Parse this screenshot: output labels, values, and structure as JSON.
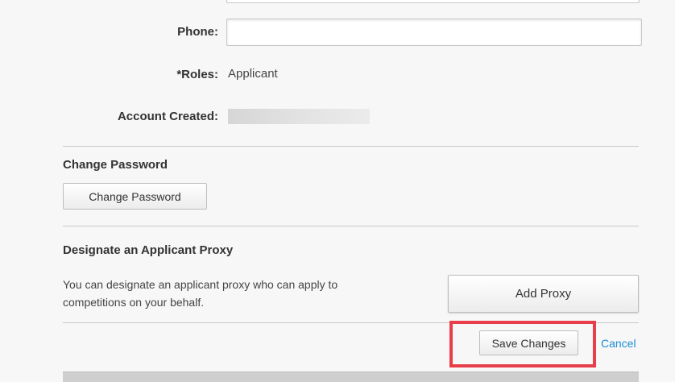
{
  "form": {
    "phone_label": "Phone:",
    "phone_value": "",
    "roles_label": "*Roles:",
    "roles_value": "Applicant",
    "account_created_label": "Account Created:"
  },
  "change_password": {
    "title": "Change Password",
    "button_label": "Change Password"
  },
  "proxy": {
    "title": "Designate an Applicant Proxy",
    "description": "You can designate an applicant proxy who can apply to competitions on your behalf.",
    "button_label": "Add Proxy"
  },
  "actions": {
    "save_label": "Save Changes",
    "cancel_label": "Cancel"
  },
  "colors": {
    "highlight": "#e83e4a",
    "link": "#1a8fd6"
  }
}
